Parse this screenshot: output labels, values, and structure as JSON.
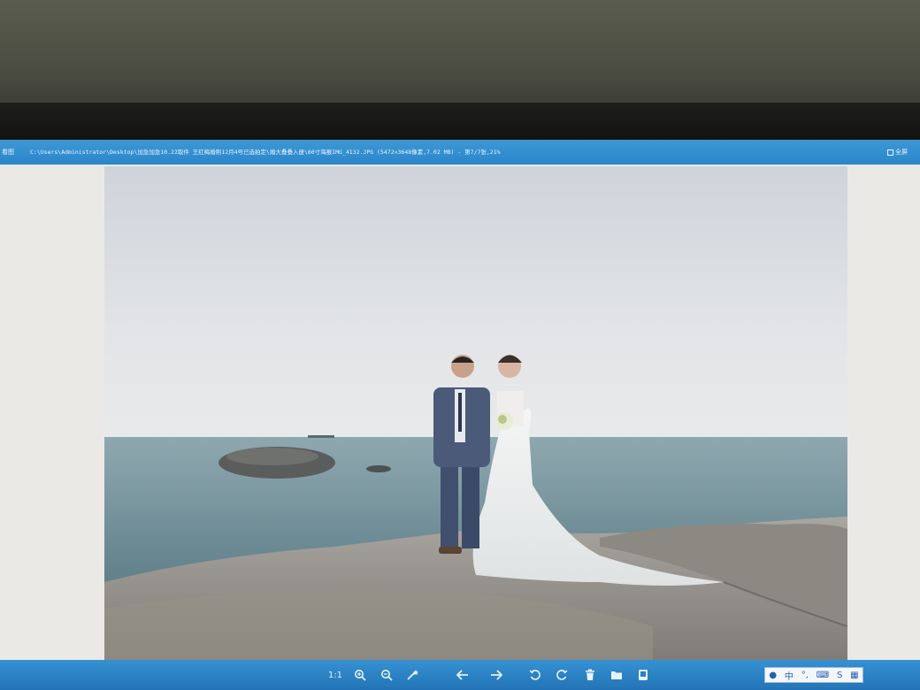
{
  "window": {
    "app_label": "看图",
    "title_path": "C:\\Users\\Administrator\\Desktop\\加急加急10.22取件 王红梅婚照12月4号已选拍定\\婚大叠叠入册\\60寸海报IMG_4132.JPG (5472×3648像素,7.02 MB) - 第7/7张,21%",
    "fullscreen_label": "全屏"
  },
  "photo": {
    "description_alt": "wedding couple on seaside rocks"
  },
  "toolbar": {
    "actual_size_label": "1:1",
    "buttons": [
      {
        "name": "actual-size-button",
        "icon": "1:1"
      },
      {
        "name": "zoom-in-button",
        "icon": "zoom-in-icon"
      },
      {
        "name": "zoom-out-button",
        "icon": "zoom-out-icon"
      },
      {
        "name": "edit-button",
        "icon": "magic-wand-icon"
      },
      {
        "name": "prev-button",
        "icon": "arrow-left-icon"
      },
      {
        "name": "next-button",
        "icon": "arrow-right-icon"
      },
      {
        "name": "rotate-left-button",
        "icon": "rotate-ccw-icon"
      },
      {
        "name": "rotate-right-button",
        "icon": "rotate-cw-icon"
      },
      {
        "name": "delete-button",
        "icon": "trash-icon"
      },
      {
        "name": "open-folder-button",
        "icon": "folder-icon"
      },
      {
        "name": "more-button",
        "icon": "copy-icon"
      }
    ]
  },
  "ime_bar": {
    "lang": "中",
    "punct": "°,",
    "label": "S"
  },
  "colors": {
    "titlebar": "#2a86c9",
    "toolbar": "#2374b6",
    "sky": "#dfe2e6",
    "sea": "#6f8f98",
    "rock": "#9a9690"
  }
}
